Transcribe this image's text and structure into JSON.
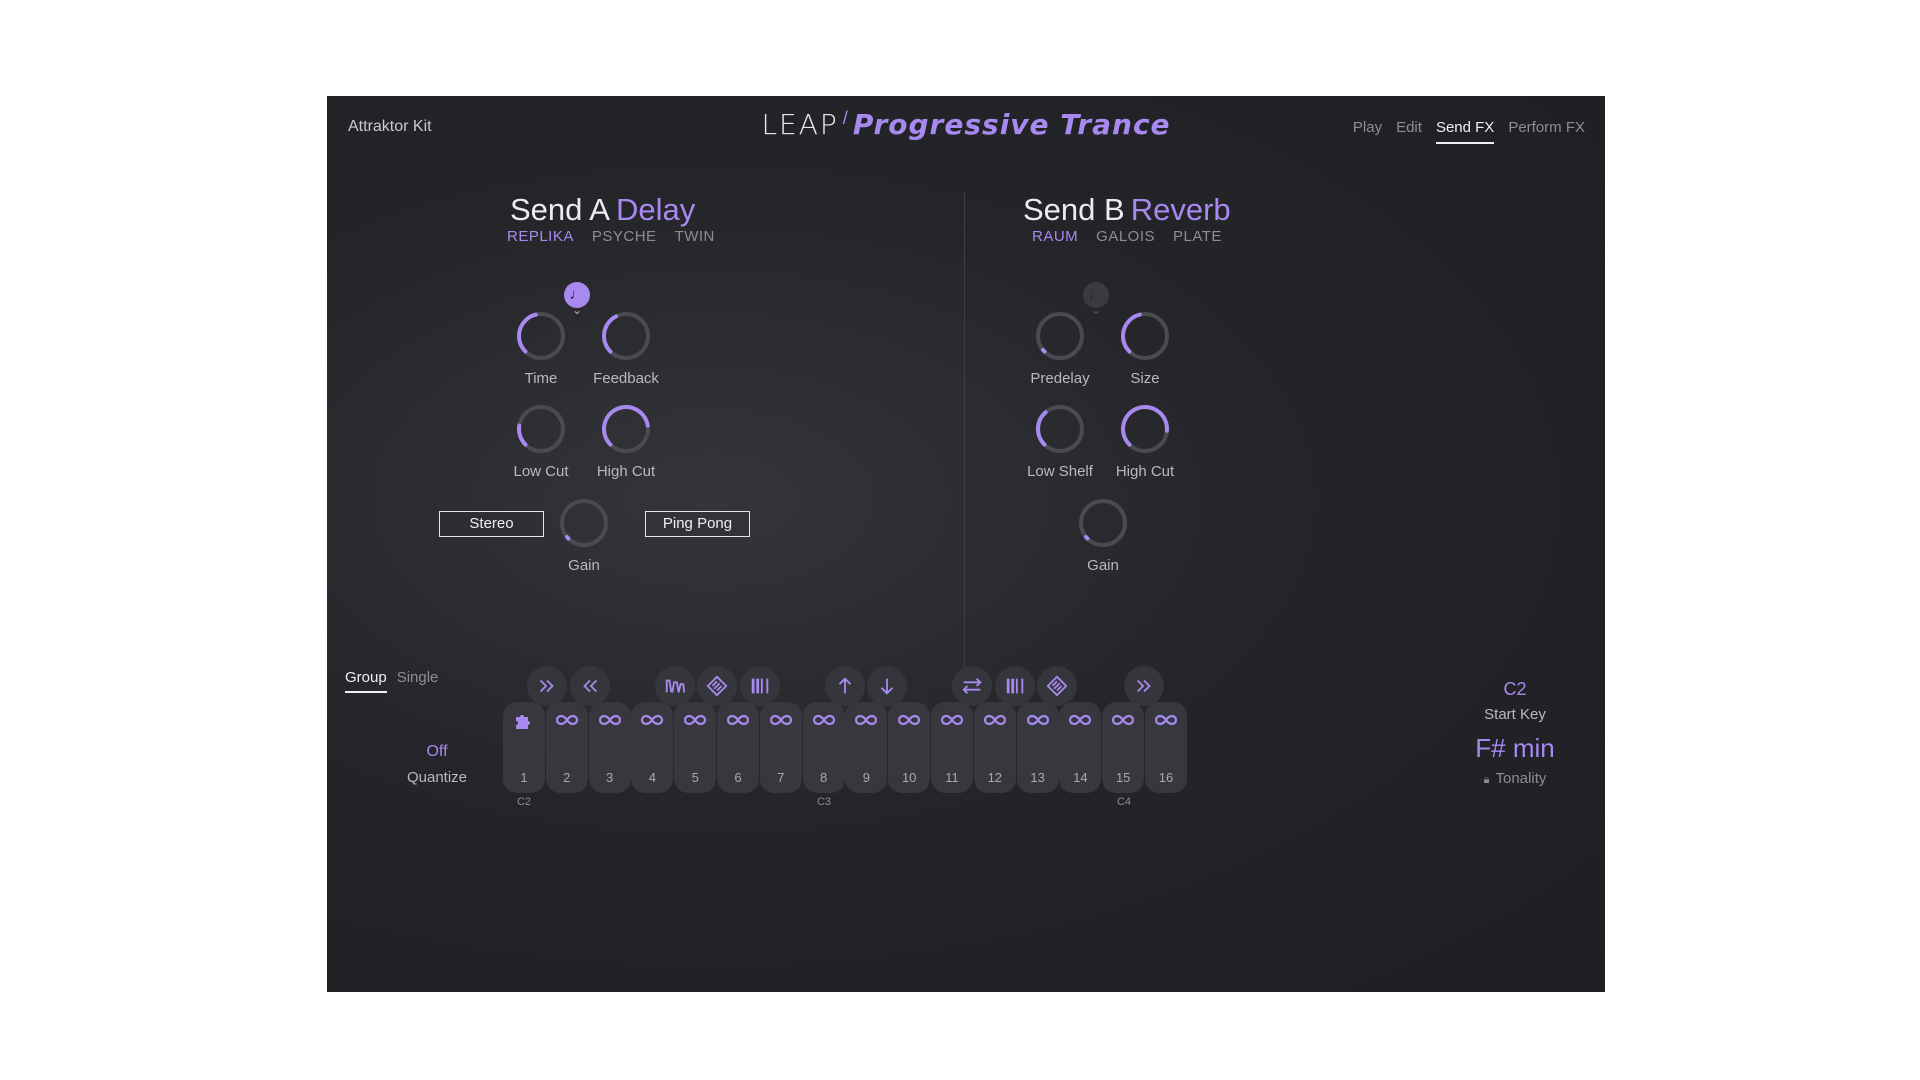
{
  "header": {
    "kit_name": "Attraktor Kit",
    "logo_leap": "LEAP",
    "logo_title": "Progressive Trance",
    "tabs": [
      {
        "label": "Play",
        "active": false
      },
      {
        "label": "Edit",
        "active": false
      },
      {
        "label": "Send FX",
        "active": true
      },
      {
        "label": "Perform FX",
        "active": false
      }
    ]
  },
  "send_a": {
    "prefix": "Send A",
    "fx": "Delay",
    "algorithms": [
      "REPLIKA",
      "PSYCHE",
      "TWIN"
    ],
    "active_algorithm": "REPLIKA",
    "sync_icon": "note-icon",
    "sync_on": true,
    "knobs": [
      {
        "label": "Time",
        "value": 0.45
      },
      {
        "label": "Feedback",
        "value": 0.4
      },
      {
        "label": "Low Cut",
        "value": 0.2
      },
      {
        "label": "High Cut",
        "value": 0.8
      },
      {
        "label": "Gain",
        "value": 0.02
      }
    ],
    "stereo_label": "Stereo",
    "pingpong_label": "Ping Pong"
  },
  "send_b": {
    "prefix": "Send B",
    "fx": "Reverb",
    "algorithms": [
      "RAUM",
      "GALOIS",
      "PLATE"
    ],
    "active_algorithm": "RAUM",
    "sync_icon": "note-icon",
    "sync_on": false,
    "knobs": [
      {
        "label": "Predelay",
        "value": 0.02
      },
      {
        "label": "Size",
        "value": 0.45
      },
      {
        "label": "Low Shelf",
        "value": 0.35
      },
      {
        "label": "High Cut",
        "value": 0.85
      },
      {
        "label": "Gain",
        "value": 0.02
      }
    ]
  },
  "bottom": {
    "mode_tabs": [
      {
        "label": "Group",
        "active": true
      },
      {
        "label": "Single",
        "active": false
      }
    ],
    "quantize_value": "Off",
    "quantize_label": "Quantize",
    "start_key_value": "C2",
    "start_key_label": "Start Key",
    "tonality_value": "F# min",
    "tonality_label": "Tonality",
    "perform_buttons": [
      "fast-forward-icon",
      "rewind-icon",
      "stutter-icon",
      "diamond-grid-icon",
      "bars-icon",
      "arrow-up-icon",
      "arrow-down-icon",
      "swap-icon",
      "bars-icon",
      "diamond-grid-icon",
      "fast-forward-icon"
    ],
    "pads": [
      "1",
      "2",
      "3",
      "4",
      "5",
      "6",
      "7",
      "8",
      "9",
      "10",
      "11",
      "12",
      "13",
      "14",
      "15",
      "16"
    ],
    "pad_icons": [
      "puzzle-icon",
      "infinity-icon",
      "infinity-icon",
      "infinity-icon",
      "infinity-icon",
      "infinity-icon",
      "infinity-icon",
      "infinity-icon",
      "infinity-icon",
      "infinity-icon",
      "infinity-icon",
      "infinity-icon",
      "infinity-icon",
      "infinity-icon",
      "infinity-icon",
      "infinity-icon"
    ],
    "octave_labels": [
      "C2",
      "C3",
      "C4"
    ]
  },
  "colors": {
    "accent": "#a889f0",
    "background": "#222327",
    "knob_track": "#4a4b50"
  }
}
